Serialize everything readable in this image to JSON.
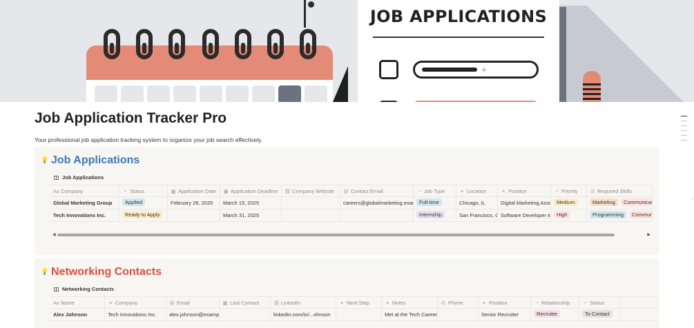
{
  "cover": {
    "title": "JOB APPLICATIONS"
  },
  "page": {
    "title": "Job Application Tracker Pro",
    "description": "Your professional job application tracking system to organize your job search effectively."
  },
  "sections": {
    "applications": {
      "heading": "Job Applications",
      "db_title": "Job Applications",
      "columns": [
        {
          "icon": "Aa",
          "label": "Company"
        },
        {
          "icon": "◔",
          "label": "Status"
        },
        {
          "icon": "▦",
          "label": "Application Date"
        },
        {
          "icon": "▦",
          "label": "Application Deadline"
        },
        {
          "icon": "⛓",
          "label": "Company Website"
        },
        {
          "icon": "@",
          "label": "Contact Email"
        },
        {
          "icon": "◔",
          "label": "Job Type"
        },
        {
          "icon": "≡",
          "label": "Location"
        },
        {
          "icon": "≡",
          "label": "Position"
        },
        {
          "icon": "◔",
          "label": "Priority"
        },
        {
          "icon": "☰",
          "label": "Required Skills"
        }
      ],
      "rows": [
        {
          "company": "Global Marketing Group",
          "status": "Applied",
          "application_date": "February 28, 2025",
          "deadline": "March 15, 2025",
          "website": "",
          "email": "careers@globalmarketing.example",
          "job_type": "Full-time",
          "location": "Chicago, IL",
          "position": "Digital Marketing Associate",
          "priority": "Medium",
          "skills": [
            "Marketing",
            "Communication"
          ]
        },
        {
          "company": "Tech Innovations Inc.",
          "status": "Ready to Apply",
          "application_date": "",
          "deadline": "March 31, 2025",
          "website": "",
          "email": "",
          "job_type": "Internship",
          "location": "San Francisco, CA",
          "position": "Software Developer Intern",
          "priority": "High",
          "skills": [
            "Programming",
            "Communication"
          ]
        }
      ]
    },
    "networking": {
      "heading": "Networking Contacts",
      "db_title": "Networking Contacts",
      "columns": [
        {
          "icon": "Aa",
          "label": "Name"
        },
        {
          "icon": "≡",
          "label": "Company"
        },
        {
          "icon": "@",
          "label": "Email"
        },
        {
          "icon": "▦",
          "label": "Last Contact"
        },
        {
          "icon": "⛓",
          "label": "LinkedIn"
        },
        {
          "icon": "≡",
          "label": "Next Step"
        },
        {
          "icon": "≡",
          "label": "Notes"
        },
        {
          "icon": "✆",
          "label": "Phone"
        },
        {
          "icon": "≡",
          "label": "Position"
        },
        {
          "icon": "◔",
          "label": "Relationship"
        },
        {
          "icon": "◔",
          "label": "Status"
        }
      ],
      "rows": [
        {
          "name": "Alex Johnson",
          "company": "Tech Innovations Inc.",
          "email": "alex.johnson@example.com",
          "last_contact": "",
          "linkedin": "linkedin.com/in/...ohnson",
          "next_step": "",
          "notes": "Met at the Tech Career Fair",
          "phone": "",
          "position": "Senior Recruiter",
          "relationship": "Recruiter",
          "status": "To Contact"
        }
      ]
    }
  },
  "tag_colors": {
    "Applied": "#d3e5ef",
    "Ready to Apply": "#fdecc8",
    "Full-time": "#d3e5ef",
    "Internship": "#e8deee",
    "Medium": "#fdecc8",
    "High": "#ffe2dd",
    "Marketing": "#fadec9",
    "Communication": "#ffe2dd",
    "Programming": "#d3e5ef",
    "Recruiter": "#f5e0e9",
    "To Contact": "#e3e2e0"
  },
  "icons": {
    "callout": "lightbulb-icon",
    "database": "table-icon",
    "scroll_left": "caret-left-icon",
    "scroll_right": "caret-right-icon"
  }
}
